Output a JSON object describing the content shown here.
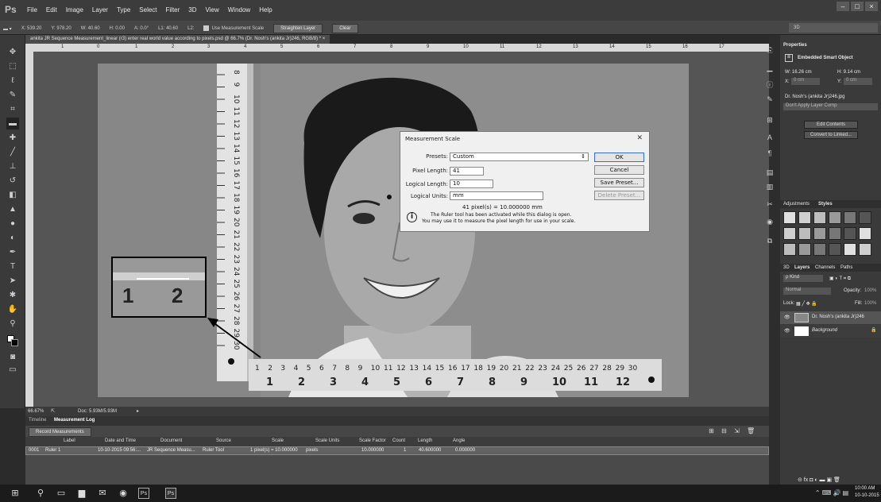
{
  "app": {
    "logo": "Ps",
    "menus": [
      "File",
      "Edit",
      "Image",
      "Layer",
      "Type",
      "Select",
      "Filter",
      "3D",
      "View",
      "Window",
      "Help"
    ],
    "window_buttons": [
      "–",
      "□",
      "×"
    ]
  },
  "options": {
    "tool_glyph": "▬ ▾",
    "x": "X: 539.20",
    "y": "Y: 978.20",
    "w": "W: 40.60",
    "h": "H: 0.00",
    "a": "A: 0.0°",
    "l1": "L1: 40.60",
    "l2": "L2:",
    "use_scale": "Use Measurement Scale",
    "straighten": "Straighten Layer",
    "clear": "Clear",
    "workspace": "3D"
  },
  "document": {
    "tab_title": "ankita JR Sequence Measurement_linear (r3) enter real world value according to pixels.psd @ 66.7% (Dr. Nosh's (ankita Jr)246, RGB/8) *",
    "tab_close": "×",
    "zoom": "66.67%",
    "doc_size": "Doc: 5.93M/5.93M",
    "ruler_marks": [
      "1",
      "0",
      "1",
      "2",
      "3",
      "4",
      "5",
      "6",
      "7",
      "8",
      "9",
      "10",
      "11",
      "12",
      "13",
      "14",
      "15",
      "16",
      "17"
    ]
  },
  "photo": {
    "inset_digits": [
      "1",
      "2"
    ],
    "ruler_vertical": [
      "8",
      "9",
      "10",
      "11",
      "12",
      "13",
      "14",
      "15",
      "16",
      "17",
      "18",
      "19",
      "20",
      "21",
      "22",
      "23",
      "24",
      "25",
      "26",
      "27",
      "28",
      "29",
      "30"
    ],
    "ruler_horizontal": [
      "1",
      "2",
      "3",
      "4",
      "5",
      "6",
      "7",
      "8",
      "9",
      "10",
      "11",
      "12",
      "13",
      "14",
      "15",
      "16",
      "17",
      "18",
      "19",
      "20",
      "21",
      "22",
      "23",
      "24",
      "25",
      "26",
      "27",
      "28",
      "29",
      "30"
    ],
    "ruler_big": [
      "1",
      "2",
      "3",
      "4",
      "5",
      "6",
      "7",
      "8",
      "9",
      "10",
      "11",
      "12"
    ]
  },
  "dialog": {
    "title": "Measurement Scale",
    "close": "✕",
    "presets_label": "Presets:",
    "presets_value": "Custom",
    "pixel_length_label": "Pixel Length:",
    "pixel_length_value": "41",
    "logical_length_label": "Logical Length:",
    "logical_length_value": "10",
    "logical_units_label": "Logical Units:",
    "logical_units_value": "mm",
    "ratio": "41 pixel(s) = 10.000000 mm",
    "info": "The Ruler tool has been activated while this dialog is open.",
    "info2": "You may use it to measure the pixel length for use in your scale.",
    "ok": "OK",
    "cancel": "Cancel",
    "save_preset": "Save Preset...",
    "delete_preset": "Delete Preset..."
  },
  "bottom": {
    "tabs": [
      "Timeline",
      "Measurement Log"
    ],
    "record": "Record Measurements",
    "columns": [
      "Label",
      "Date and Time",
      "Document",
      "Source",
      "Scale",
      "Scale Units",
      "Scale Factor",
      "Count",
      "Length",
      "Angle"
    ],
    "row": [
      "0001",
      "Ruler 1",
      "10-10-2015 09:56:...",
      "JR Sequence Measu...",
      "Ruler Tool",
      "1 pixel(s) = 10.000000",
      "pixels",
      "10.000000",
      "1",
      "40.600000",
      "0.000000"
    ]
  },
  "properties": {
    "tab": "Properties",
    "object": "Embedded Smart Object",
    "w": "W: 16.26 cm",
    "h": "H: 9.14 cm",
    "x_label": "X:",
    "x_value": "0 cm",
    "y_label": "Y:",
    "y_value": "0 cm",
    "file": "Dr. Nosh's (ankita Jr)246.jpg",
    "layer_comp": "Don't Apply Layer Comp",
    "edit_contents": "Edit Contents",
    "convert": "Convert to Linked..."
  },
  "styles": {
    "tabs": [
      "Adjustments",
      "Styles"
    ]
  },
  "layers": {
    "tabs": [
      "3D",
      "Layers",
      "Channels",
      "Paths"
    ],
    "kind": "ρ Kind",
    "blend": "Normal",
    "opacity_label": "Opacity:",
    "opacity": "100%",
    "lock_label": "Lock:",
    "fill_label": "Fill:",
    "fill": "100%",
    "items": [
      "Dr. Nosh's (ankita Jr)246",
      "Background"
    ]
  },
  "taskbar": {
    "time": "10:00 AM",
    "date": "10-10-2015"
  }
}
